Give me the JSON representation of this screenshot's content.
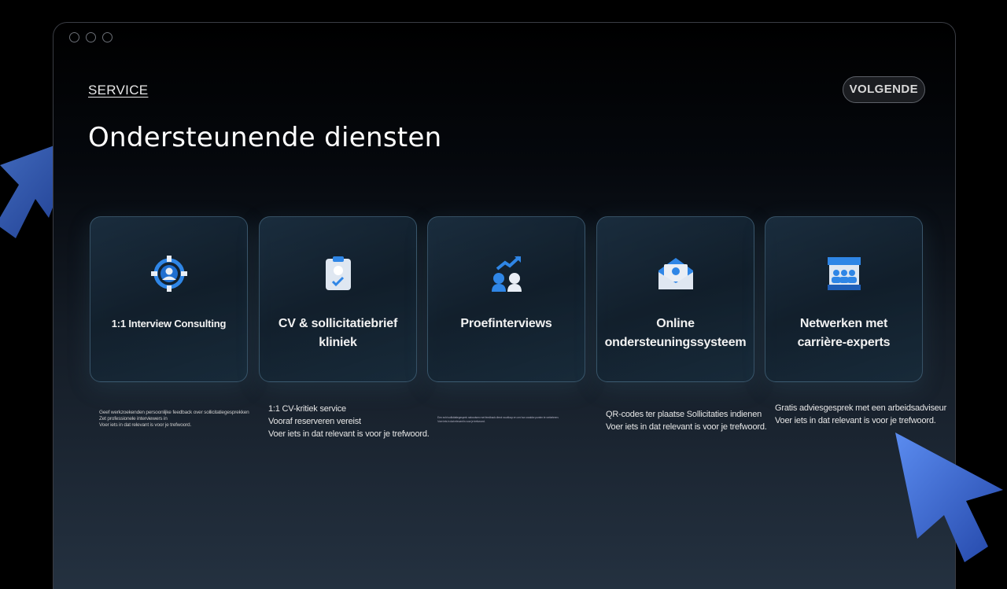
{
  "header": {
    "section_label": "SERVICE",
    "next_button": "VOLGENDE",
    "title": "Ondersteunende diensten"
  },
  "cards": [
    {
      "label": "1:1 Interview Consulting",
      "icon": "person-target-icon",
      "description": [
        "Geef werkzoekenden persoonlijke feedback over sollicitatiegesprekken",
        "Zet professionele interviewers in",
        "Voer iets in dat relevant is voor je trefwoord."
      ]
    },
    {
      "label_lines": [
        "CV & sollicitatiebrief",
        "kliniek"
      ],
      "icon": "clipboard-check-icon",
      "description": [
        "1:1 CV-kritiek service",
        "Vooraf reserveren vereist",
        "Voer iets in dat relevant is voor je trefwoord."
      ]
    },
    {
      "label": "Proefinterviews",
      "icon": "people-growth-icon",
      "description": [
        "Een echt sollicitatiegesprek nabootsen met feedback direct na afloop en om hun zwakke punten te verbeteren.",
        "Voer iets in dat relevant is voor je trefwoord."
      ]
    },
    {
      "label_lines": [
        "Online",
        "ondersteuningssysteem"
      ],
      "icon": "envelope-icon",
      "description": [
        "QR-codes ter plaatse Sollicitaties indienen",
        "Voer iets in dat relevant is voor je trefwoord."
      ]
    },
    {
      "label_lines": [
        "Netwerken met",
        "carrière-experts"
      ],
      "icon": "presentation-board-icon",
      "description": [
        "Gratis adviesgesprek met een arbeidsadviseur",
        "Voer iets in dat relevant is voor je trefwoord."
      ]
    }
  ],
  "colors": {
    "accent": "#2f86e6",
    "cursor": "#3b64c8"
  }
}
